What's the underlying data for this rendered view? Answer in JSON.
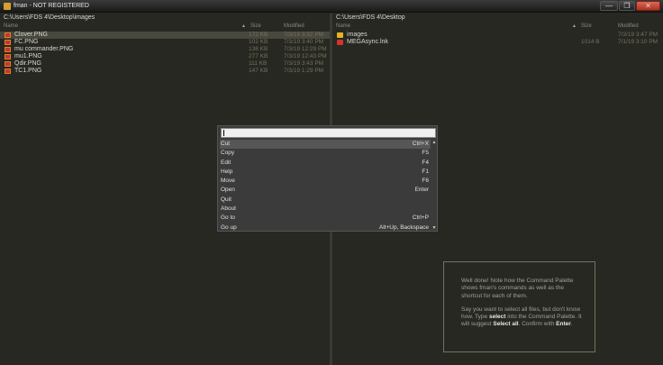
{
  "window": {
    "title": "fman - NOT REGISTERED",
    "min_glyph": "—",
    "max_glyph": "❐",
    "close_glyph": "✕"
  },
  "left_pane": {
    "path": "C:\\Users\\FDS 4\\Desktop\\images",
    "columns": {
      "name": "Name",
      "size": "Size",
      "modified": "Modified",
      "sort_indicator": "▲"
    },
    "files": [
      {
        "name": "Clover.PNG",
        "size": "172 KB",
        "modified": "7/3/19 3:32 PM",
        "icon": "png-icon"
      },
      {
        "name": "FC.PNG",
        "size": "102 KB",
        "modified": "7/3/19 3:40 PM",
        "icon": "png-icon"
      },
      {
        "name": "mu commander.PNG",
        "size": "138 KB",
        "modified": "7/3/19 12:29 PM",
        "icon": "png-icon"
      },
      {
        "name": "mu1.PNG",
        "size": "277 KB",
        "modified": "7/3/19 12:43 PM",
        "icon": "png-icon"
      },
      {
        "name": "Qdir.PNG",
        "size": "111 KB",
        "modified": "7/3/19 3:43 PM",
        "icon": "png-icon"
      },
      {
        "name": "TC1.PNG",
        "size": "147 KB",
        "modified": "7/3/19 1:29 PM",
        "icon": "png-icon"
      }
    ]
  },
  "right_pane": {
    "path": "C:\\Users\\FDS 4\\Desktop",
    "columns": {
      "name": "Name",
      "size": "Size",
      "modified": "Modified",
      "sort_indicator": "▲"
    },
    "files": [
      {
        "name": "images",
        "size": "",
        "modified": "7/3/19 3:47 PM",
        "icon": "folder-icon"
      },
      {
        "name": "MEGAsync.lnk",
        "size": "1014 B",
        "modified": "7/1/19 3:10 PM",
        "icon": "shortcut-icon"
      }
    ]
  },
  "command_palette": {
    "query": "",
    "scroll_up": "▲",
    "scroll_down": "▼",
    "commands": [
      {
        "label": "Cut",
        "shortcut": "Ctrl+X"
      },
      {
        "label": "Copy",
        "shortcut": "F5"
      },
      {
        "label": "Edit",
        "shortcut": "F4"
      },
      {
        "label": "Help",
        "shortcut": "F1"
      },
      {
        "label": "Move",
        "shortcut": "F6"
      },
      {
        "label": "Open",
        "shortcut": "Enter"
      },
      {
        "label": "Quit",
        "shortcut": ""
      },
      {
        "label": "About",
        "shortcut": ""
      },
      {
        "label": "Go to",
        "shortcut": "Ctrl+P"
      },
      {
        "label": "Go up",
        "shortcut": "Alt+Up, Backspace"
      }
    ]
  },
  "tutorial": {
    "p1": "Well done! Note how the Command Palette shows fman's commands as well as the shortcut for each of them.",
    "p2_a": "Say you want to select all files, but don't know how. Type ",
    "p2_b": "select",
    "p2_c": " into the Command Palette. It will suggest ",
    "p2_d": "Select all",
    "p2_e": ". Confirm with ",
    "p2_f": "Enter",
    "p2_g": "."
  }
}
